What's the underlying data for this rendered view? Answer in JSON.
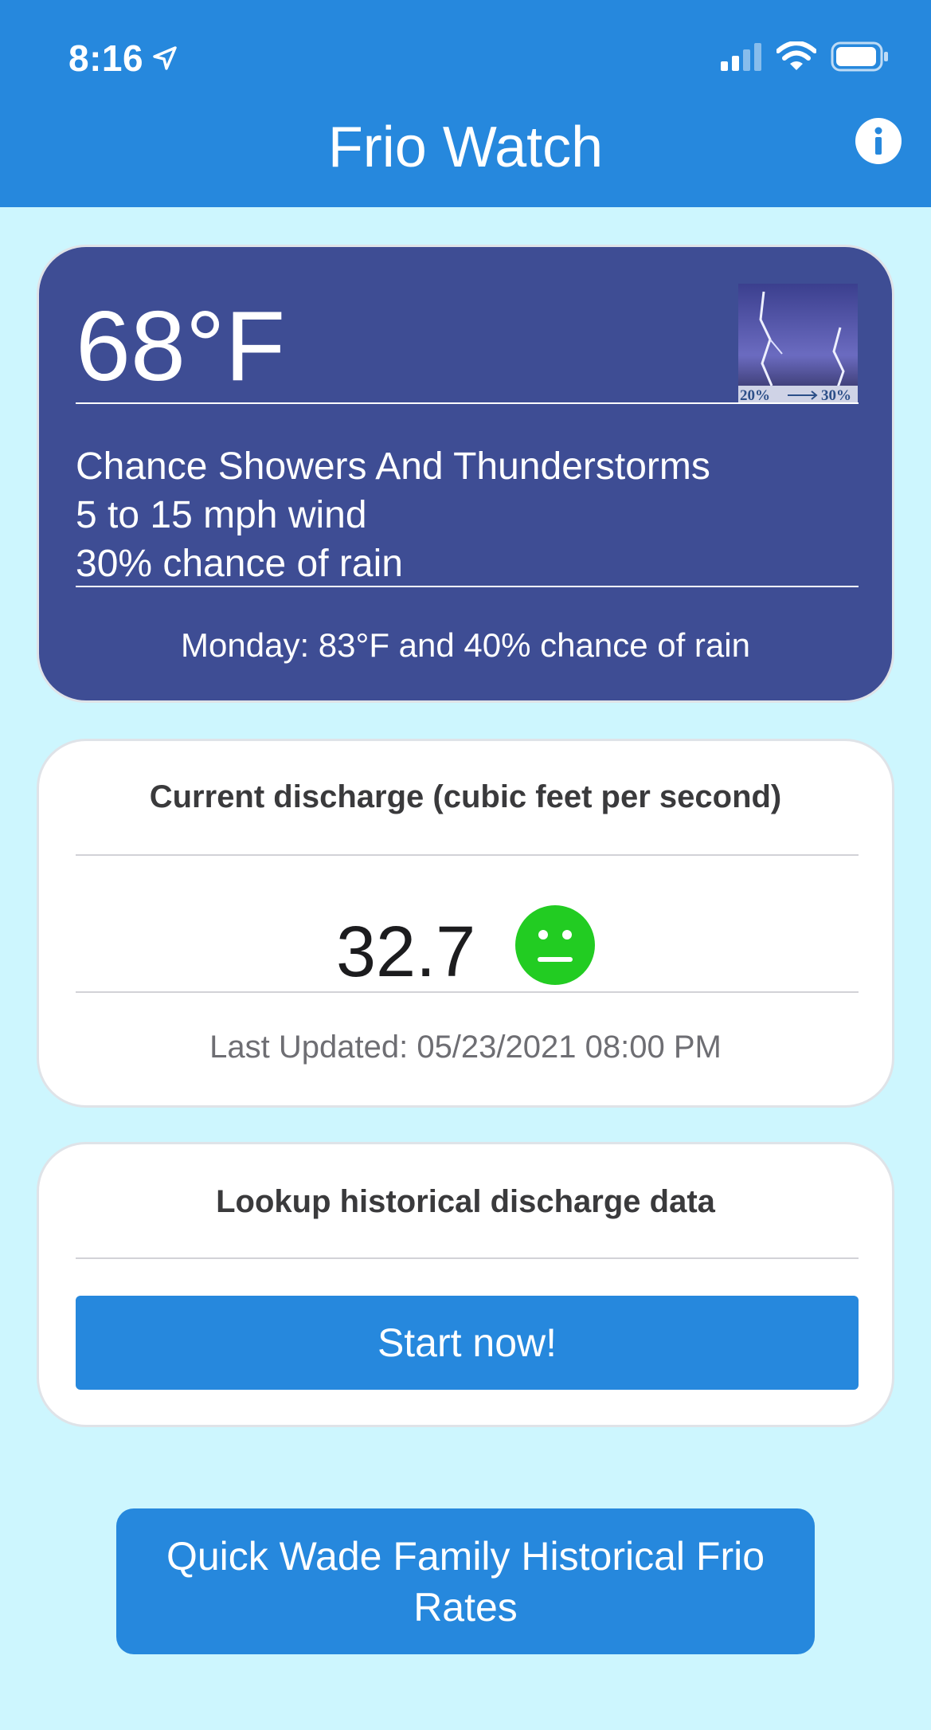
{
  "status_bar": {
    "time": "8:16"
  },
  "header": {
    "title": "Frio Watch"
  },
  "weather": {
    "temperature": "68°F",
    "condition": "Chance Showers And Thunderstorms",
    "wind": "5 to 15 mph wind",
    "rain_chance": "30% chance of rain",
    "forecast": "Monday: 83°F and 40% chance of rain",
    "image_caption_left": "20%",
    "image_caption_right": "30%"
  },
  "discharge": {
    "heading": "Current discharge (cubic feet per second)",
    "value": "32.7",
    "status_face": "neutral-face-icon",
    "status_color": "#22cc22",
    "last_updated": "Last Updated: 05/23/2021 08:00 PM"
  },
  "history": {
    "heading": "Lookup historical discharge data",
    "start_label": "Start now!"
  },
  "quick_link": {
    "label": "Quick Wade Family Historical Frio Rates"
  },
  "colors": {
    "header_bg": "#2688dd",
    "page_bg": "#cdf6fe",
    "weather_card_bg": "#3e4d94",
    "button_bg": "#2688dd"
  }
}
